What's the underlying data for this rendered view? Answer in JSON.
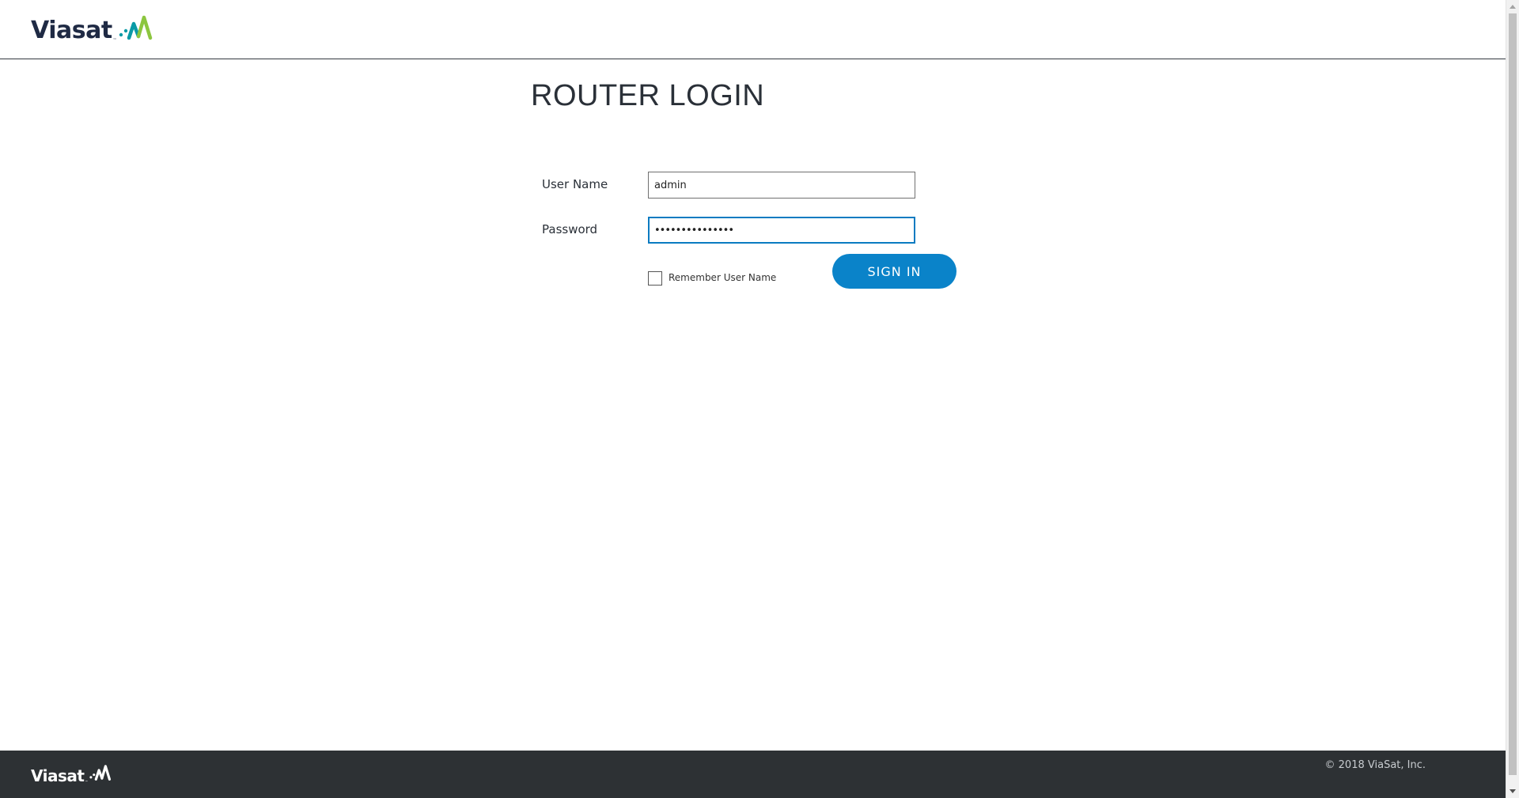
{
  "header": {
    "logo_text": "Viasat",
    "logo_tm": "™"
  },
  "login": {
    "title": "ROUTER LOGIN",
    "username_label": "User Name",
    "username_value": "admin",
    "password_label": "Password",
    "password_mask": "•••••••••••••••",
    "remember_label": "Remember User Name",
    "remember_checked": false,
    "signin_label": "SIGN IN"
  },
  "footer": {
    "logo_text": "Viasat",
    "logo_tm": "™",
    "copyright": "© 2018 ViaSat, Inc."
  },
  "colors": {
    "primary_button": "#0a83c9",
    "focus_border": "#0a7bc1",
    "footer_bg": "#2d3134",
    "logo_text_dark": "#1f2a44",
    "logo_mark_teal": "#0a9aa6",
    "logo_mark_green": "#8cc63f"
  },
  "icons": {
    "logo_mark": "viasat-wave-icon",
    "checkbox": "checkbox-unchecked"
  }
}
